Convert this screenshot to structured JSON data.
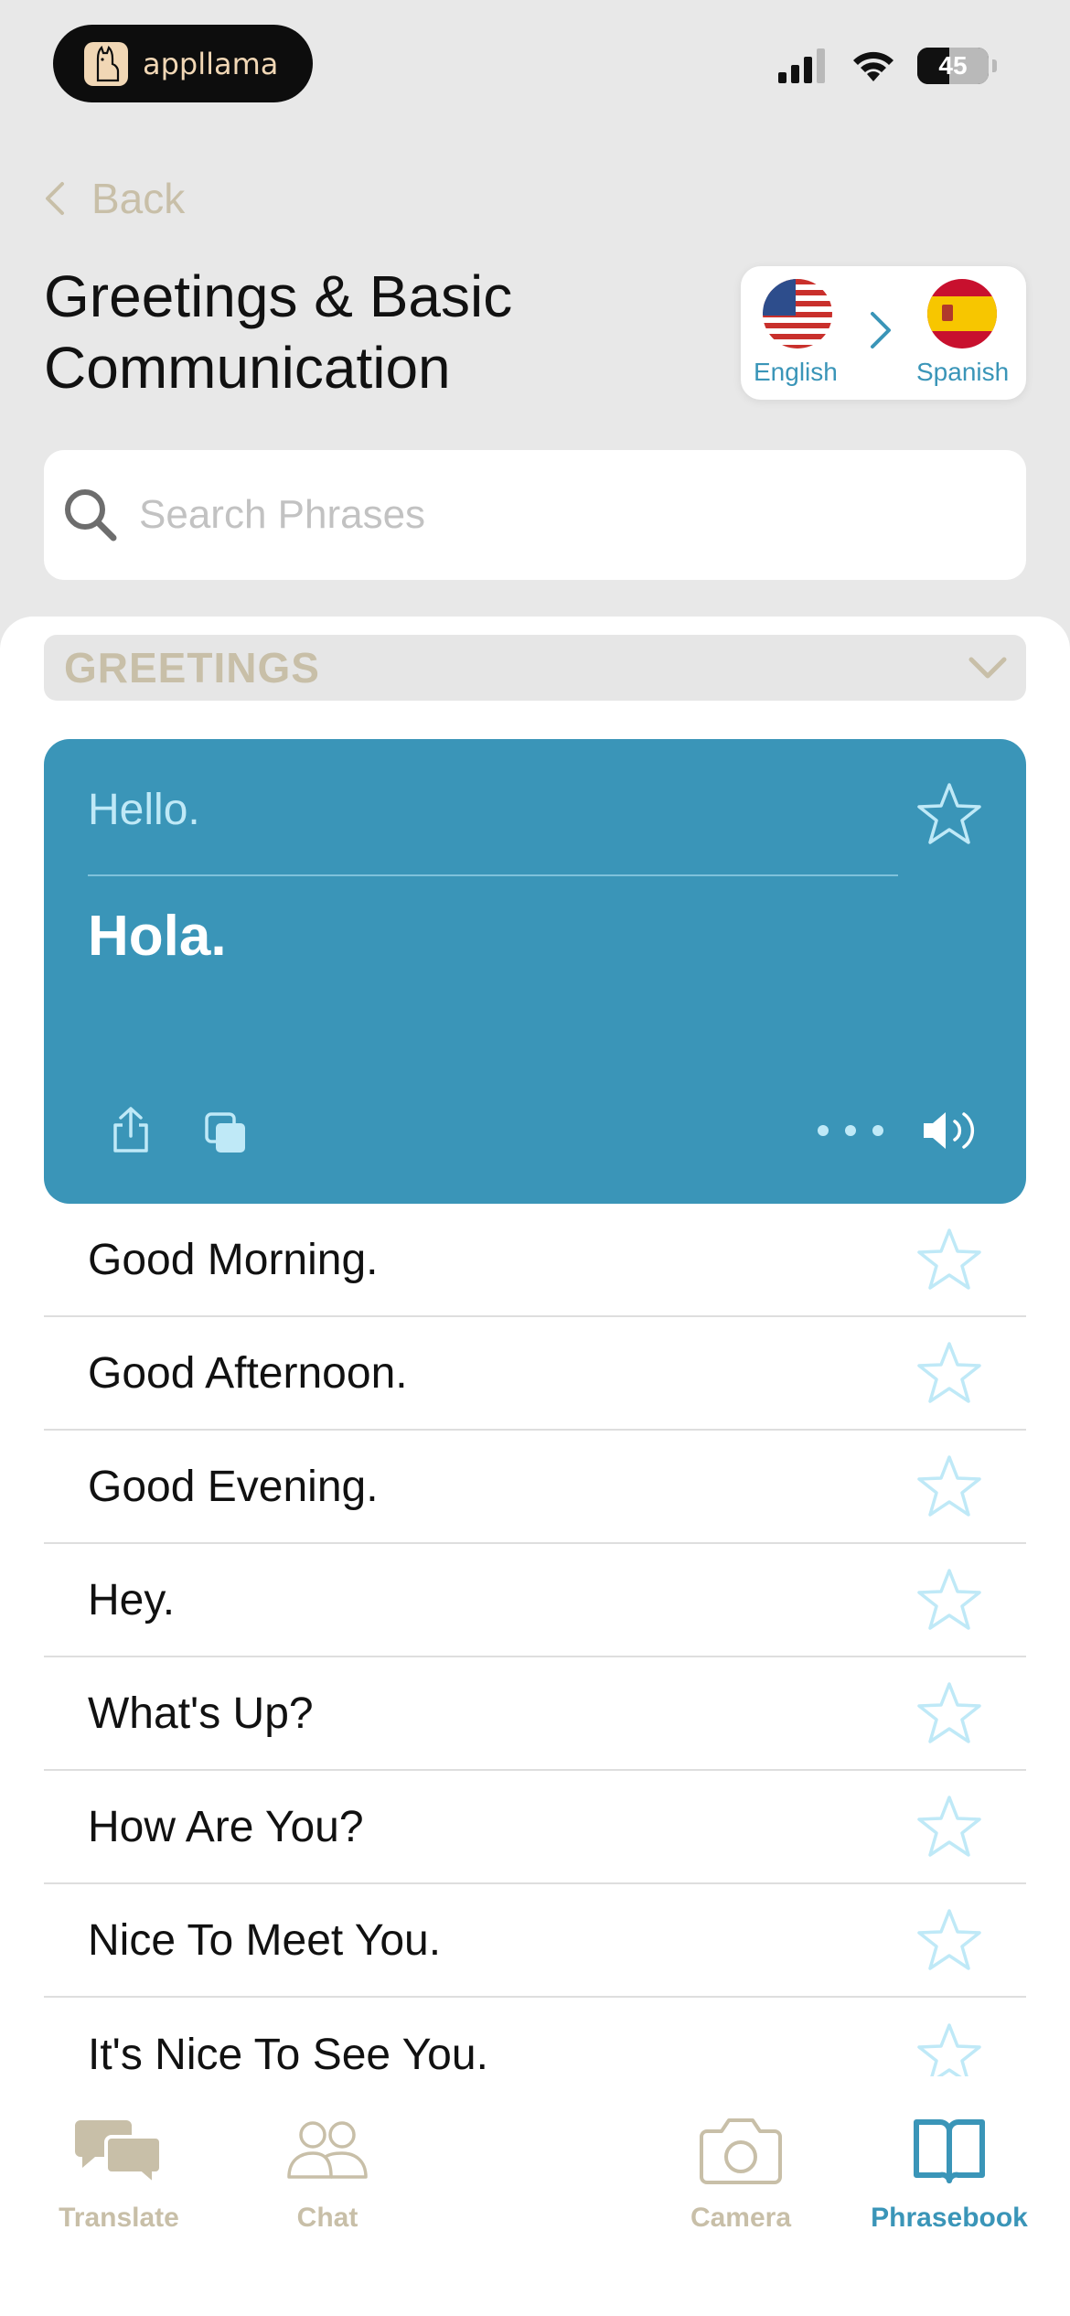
{
  "status_bar": {
    "app_name": "appllama",
    "battery_level": "45"
  },
  "nav": {
    "back_label": "Back"
  },
  "page": {
    "title": "Greetings & Basic Communication"
  },
  "language": {
    "source": "English",
    "target": "Spanish"
  },
  "search": {
    "placeholder": "Search Phrases"
  },
  "section": {
    "title": "GREETINGS"
  },
  "selected_phrase": {
    "source": "Hello.",
    "translation": "Hola."
  },
  "phrases": [
    "Good Morning.",
    "Good Afternoon.",
    "Good Evening.",
    "Hey.",
    "What's Up?",
    "How Are You?",
    "Nice To Meet You.",
    "It's Nice To See You."
  ],
  "tabs": [
    {
      "label": "Translate",
      "icon": "chat-bubbles-icon"
    },
    {
      "label": "Chat",
      "icon": "people-icon"
    },
    {
      "label": "Camera",
      "icon": "camera-icon"
    },
    {
      "label": "Phrasebook",
      "icon": "book-icon",
      "active": true
    }
  ],
  "colors": {
    "accent": "#3a95b8",
    "muted_label": "#c8bfa8",
    "star_outline": "#bfe9f7"
  }
}
